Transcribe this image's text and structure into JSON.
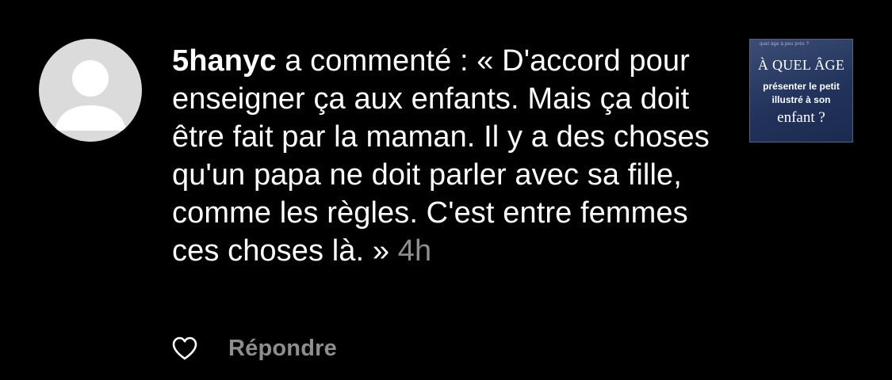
{
  "comment": {
    "username": "5hanyc",
    "text": " a commenté : « D'accord pour enseigner ça aux enfants. Mais ça doit être fait par la maman. Il y a des choses qu'un papa ne doit parler avec sa fille, comme les règles. C'est entre femmes ces choses là. » ",
    "time": "4h"
  },
  "thumbnail": {
    "tiny_text": "quel âge à peu près ?",
    "line1": "À QUEL ÂGE",
    "line2": "présenter le petit illustré à son",
    "line3": "enfant ?"
  },
  "actions": {
    "like_icon": "heart-outline-icon",
    "reply_label": "Répondre"
  },
  "colors": {
    "background": "#000000",
    "text": "#ffffff",
    "secondary": "#8e8e8e",
    "avatar": "#dbdbdb",
    "thumbnail_bg": "#22335c"
  }
}
